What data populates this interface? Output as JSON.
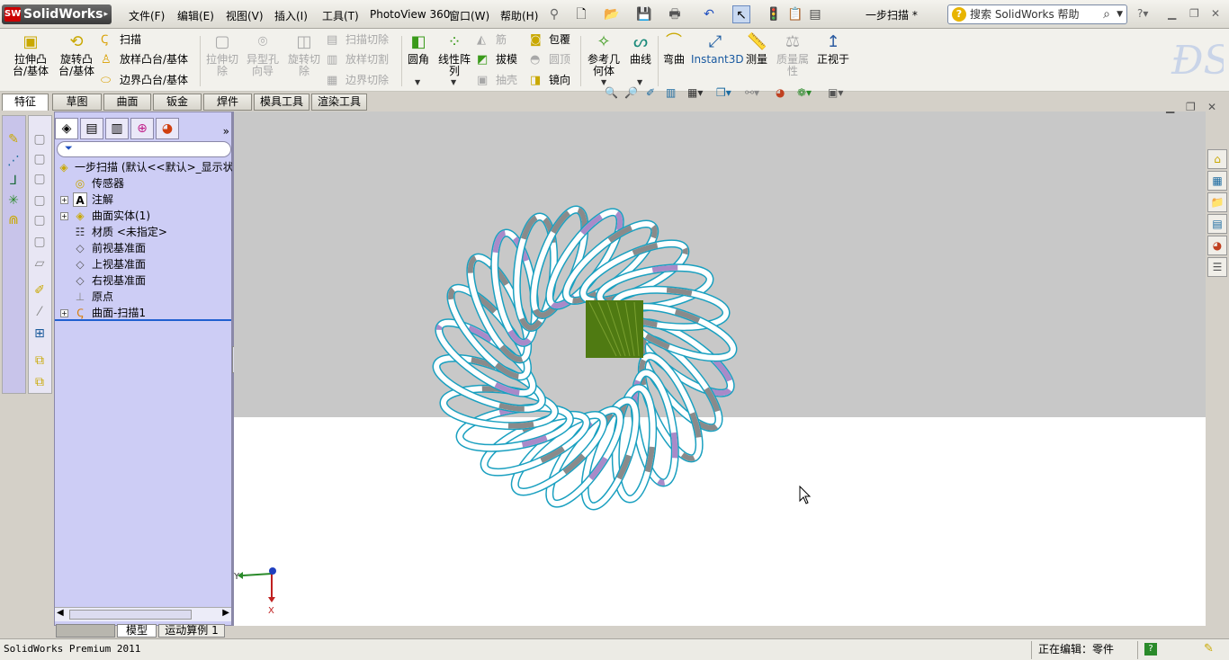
{
  "app": {
    "name": "SolidWorks",
    "badge": "SW"
  },
  "menu": [
    "文件(F)",
    "编辑(E)",
    "视图(V)",
    "插入(I)",
    "工具(T)",
    "PhotoView 360",
    "窗口(W)",
    "帮助(H)"
  ],
  "document_title": "一步扫描 *",
  "search": {
    "placeholder": "搜索 SolidWorks 帮助"
  },
  "ribbon": {
    "extrude_boss": "拉伸凸\n台/基体",
    "revolve_boss": "旋转凸\n台/基体",
    "sweep": "扫描",
    "loft_boss": "放样凸台/基体",
    "boundary_boss": "边界凸台/基体",
    "extrude_cut": "拉伸切\n除",
    "hole_wizard": "异型孔\n向导",
    "revolve_cut": "旋转切\n除",
    "swept_cut": "扫描切除",
    "lofted_cut": "放样切割",
    "boundary_cut": "边界切除",
    "fillet": "圆角",
    "linear_pattern": "线性阵\n列",
    "rib": "筋",
    "draft": "拔模",
    "shell": "抽壳",
    "wrap": "包覆",
    "dome": "圆顶",
    "mirror": "镜向",
    "reference_geometry": "参考几\n何体",
    "curves": "曲线",
    "flex": "弯曲",
    "instant3d": "Instant3D",
    "measure": "测量",
    "mass_properties": "质量属\n性",
    "normal_to": "正视于"
  },
  "tabs": [
    "特征",
    "草图",
    "曲面",
    "钣金",
    "焊件",
    "模具工具",
    "渲染工具"
  ],
  "feature_tree": {
    "root": "一步扫描  (默认<<默认>_显示状",
    "items": [
      {
        "label": "传感器",
        "expandable": false
      },
      {
        "label": "注解",
        "expandable": true
      },
      {
        "label": "曲面实体(1)",
        "expandable": true
      },
      {
        "label": "材质 <未指定>",
        "expandable": false
      },
      {
        "label": "前视基准面",
        "expandable": false
      },
      {
        "label": "上视基准面",
        "expandable": false
      },
      {
        "label": "右视基准面",
        "expandable": false
      },
      {
        "label": "原点",
        "expandable": false
      },
      {
        "label": "曲面-扫描1",
        "expandable": true
      }
    ]
  },
  "triad": {
    "x": "X",
    "y": "Y"
  },
  "bottom_tabs": [
    "模型",
    "运动算例 1"
  ],
  "status": {
    "product": "SolidWorks Premium 2011",
    "editing": "正在编辑：零件"
  },
  "colors": {
    "viewport_top": "#c8c8c8",
    "featuremanager": "#cdcdf5",
    "ribbon_outline": "#1aa0c0",
    "ribbon_face": "#ffffff",
    "leaf_green": "#4f7a12"
  }
}
